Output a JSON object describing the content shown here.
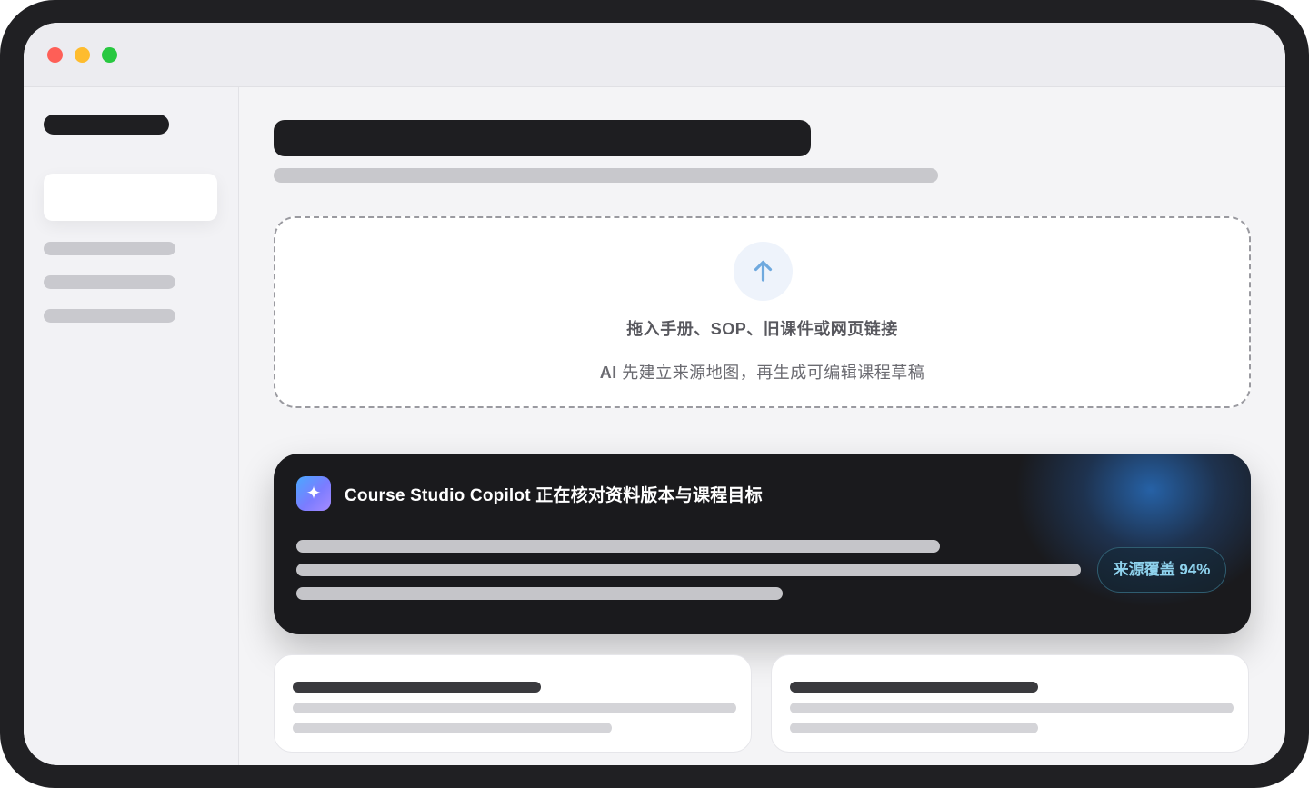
{
  "window": {
    "controls": [
      "close",
      "minimize",
      "zoom"
    ]
  },
  "dropzone": {
    "icon": "upload-arrow-icon",
    "title": "拖入手册、SOP、旧课件或网页链接",
    "subtitle_prefix": "AI",
    "subtitle_rest": " 先建立来源地图，再生成可编辑课程草稿"
  },
  "copilot": {
    "icon": "sparkle-icon",
    "title": "Course Studio Copilot 正在核对资料版本与课程目标",
    "coverage": "来源覆盖 94%",
    "colors": {
      "accent": "#8fd3ee",
      "card_bg": "#1a1a1d"
    }
  },
  "colors": {
    "close": "#fe5f57",
    "minimize": "#febc2e",
    "zoom": "#28c840",
    "upload_icon": "#6fa9de"
  }
}
